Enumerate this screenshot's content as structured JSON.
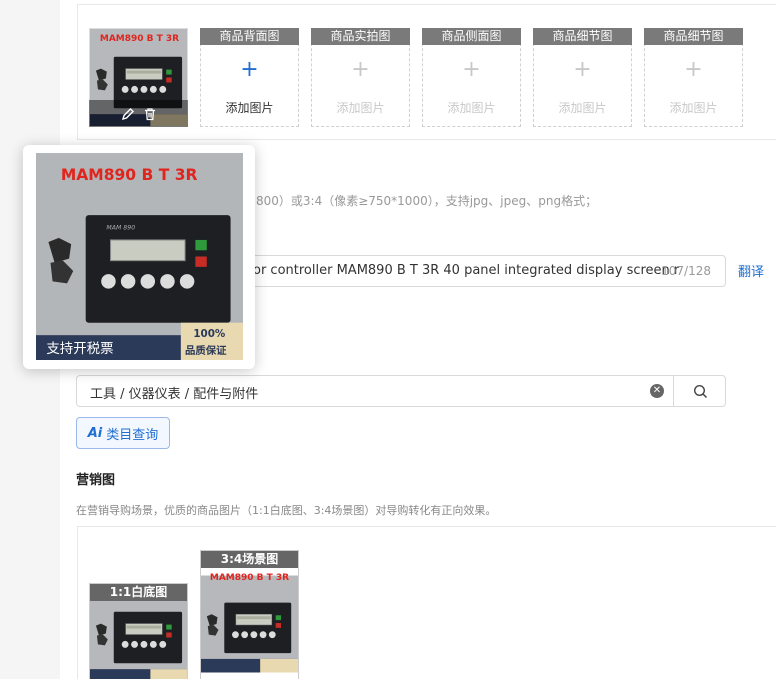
{
  "gallery": {
    "slots": [
      {
        "header": "商品背面图",
        "add_label": "添加图片",
        "active": true
      },
      {
        "header": "商品实拍图",
        "add_label": "添加图片",
        "active": false
      },
      {
        "header": "商品侧面图",
        "add_label": "添加图片",
        "active": false
      },
      {
        "header": "商品细节图",
        "add_label": "添加图片",
        "active": false
      },
      {
        "header": "商品细节图",
        "add_label": "添加图片",
        "active": false
      }
    ],
    "plus_glyph": "+",
    "tools": {
      "edit_icon": "pencil-icon",
      "delete_icon": "trash-icon"
    }
  },
  "product_image": {
    "model_text": "MAM890 B T 3R",
    "brand_text": "MAM 890",
    "badge_left": "支持开税票",
    "badge_pct": "100%",
    "badge_right": "品质保证"
  },
  "image_hint": "800）或3:4（像素≥750*1000），支持jpg、jpeg、png格式；",
  "title_field": {
    "value": "or controller MAM890 B T 3R 40 panel integrated display screen r",
    "count": "107/128",
    "translate_label": "翻译"
  },
  "category": {
    "value": "工具 / 仪器仪表 / 配件与附件",
    "clear_icon": "clear-circle-icon",
    "search_icon": "search-icon",
    "ai_mark": "Ai",
    "ai_label": "类目查询"
  },
  "marketing": {
    "title": "营销图",
    "description": "在营销导购场景，优质的商品图片（1:1白底图、3:4场景图）对导购转化有正向效果。",
    "tiles": [
      {
        "header": "1:1白底图"
      },
      {
        "header": "3:4场景图"
      }
    ]
  },
  "colors": {
    "accent": "#1f6fd2",
    "slot_header": "#7a7a7a",
    "badge_red": "#e0251f"
  }
}
